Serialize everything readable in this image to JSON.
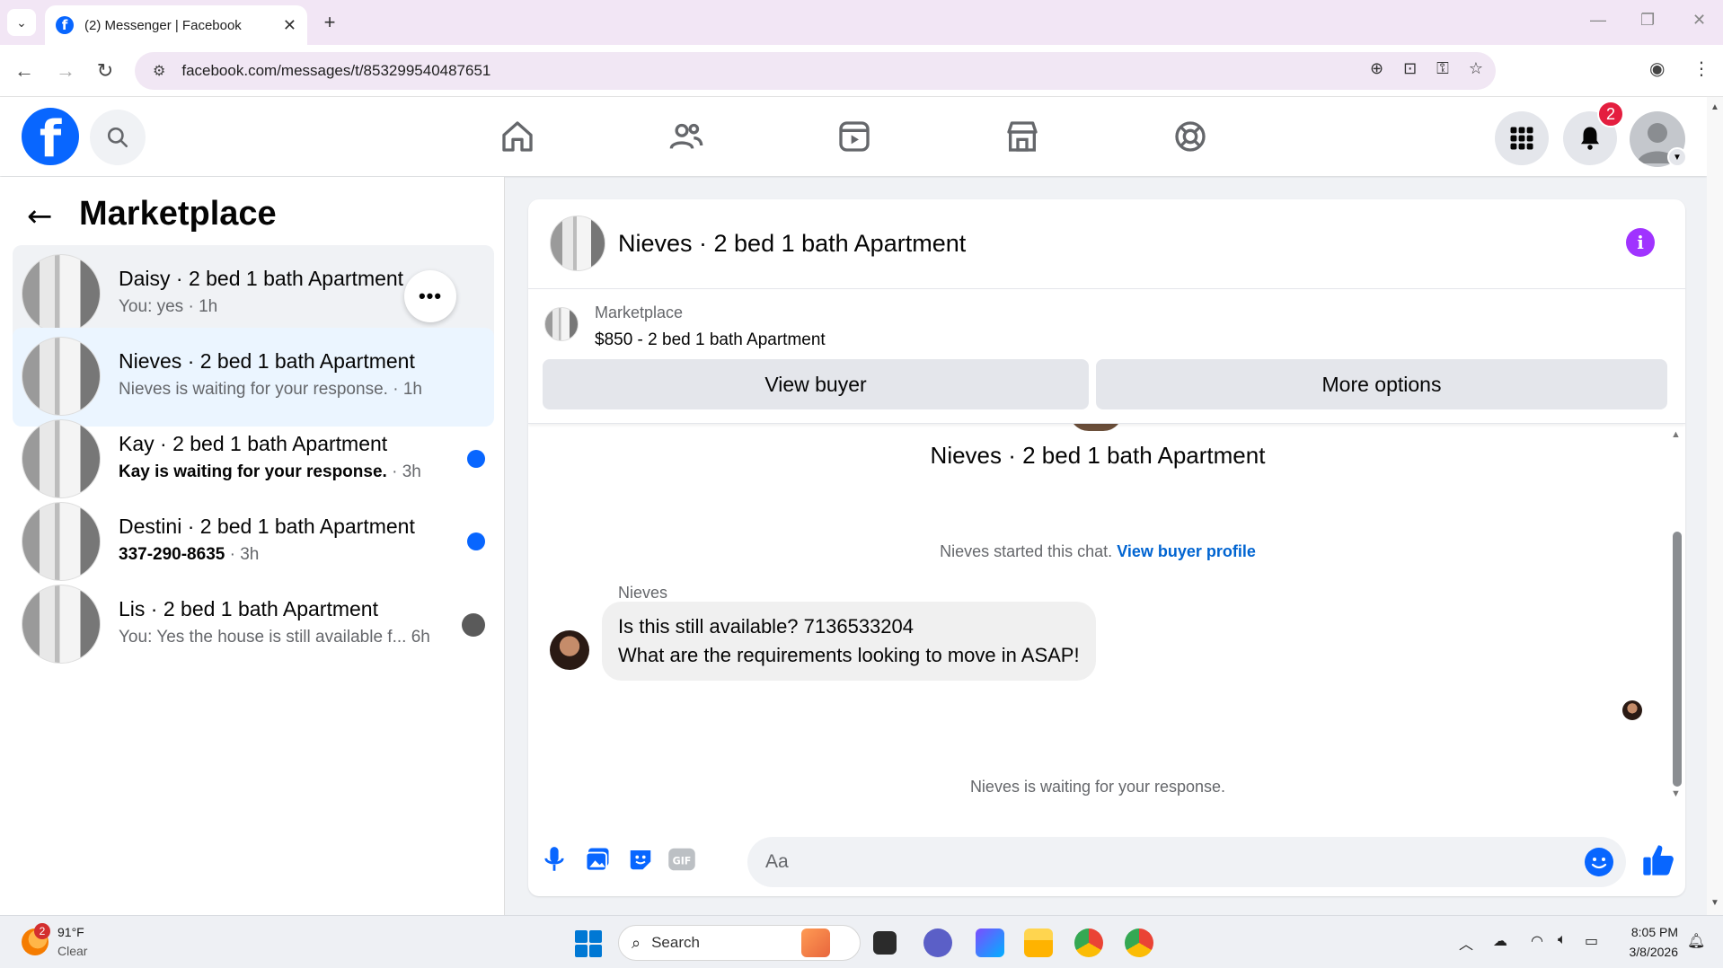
{
  "browser": {
    "tab_title": "(2) Messenger | Facebook",
    "tab_close": "✕",
    "new_tab": "+",
    "url": "facebook.com/messages/t/853299540487651"
  },
  "fb": {
    "notification_count": "2"
  },
  "sidebar": {
    "title": "Marketplace",
    "conversations": [
      {
        "name": "Daisy · 2 bed 1 bath Apartment",
        "preview": "You: yes",
        "time": "1h",
        "unread": false
      },
      {
        "name": "Nieves · 2 bed 1 bath Apartment",
        "preview": "Nieves is waiting for your response.",
        "time": "1h",
        "unread": false
      },
      {
        "name": "Kay · 2 bed 1 bath Apartment",
        "preview": "Kay is waiting for your response.",
        "time": "3h",
        "unread": true
      },
      {
        "name": "Destini · 2 bed 1 bath Apartment",
        "preview": "337-290-8635",
        "time": "3h",
        "unread": true
      },
      {
        "name": "Lis · 2 bed 1 bath Apartment",
        "preview": "You: Yes the house is still available f...",
        "time": "6h",
        "unread": false
      }
    ],
    "more_label": "•••"
  },
  "chat": {
    "title": "Nieves · 2 bed 1 bath Apartment",
    "marketplace_label": "Marketplace",
    "listing": "$850 - 2 bed 1 bath Apartment",
    "view_buyer": "View buyer",
    "more_options": "More options",
    "thread_title": "Nieves · 2 bed 1 bath Apartment",
    "started_text": "Nieves started this chat.",
    "view_buyer_profile": "View buyer profile",
    "sender": "Nieves",
    "message_line1": "Is this still available? 7136533204",
    "message_line2": "What are the requirements looking to move in ASAP!",
    "waiting_text": "Nieves is waiting for your response.",
    "composer_placeholder": "Aa"
  },
  "taskbar": {
    "weather_badge": "2",
    "temperature": "91°F",
    "condition": "Clear",
    "search_label": "Search",
    "time": "8:05 PM",
    "date": "3/8/2026"
  }
}
